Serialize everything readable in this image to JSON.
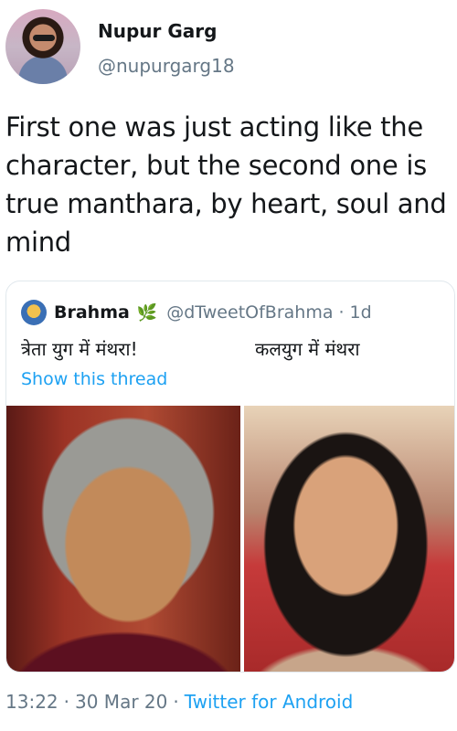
{
  "author": {
    "name": "Nupur Garg",
    "handle": "@nupurgarg18"
  },
  "tweet": {
    "text": "First one was just acting like the character, but the second one is true manthara, by heart, soul and mind"
  },
  "quoted_tweet": {
    "name": "Brahma",
    "name_icon": "leaf-icon",
    "handle": "@dTweetOfBrahma",
    "separator": "·",
    "time": "1d",
    "text_left": "त्रेता युग में मंथरा!",
    "text_right": "कलयुग में मंथरा",
    "show_thread": "Show this thread"
  },
  "footer": {
    "time": "13:22",
    "sep1": "·",
    "date": "30 Mar 20",
    "sep2": "·",
    "app": "Twitter for Android"
  },
  "colors": {
    "link": "#1da1f2",
    "secondary_text": "#657786",
    "border": "#e1e8ed"
  }
}
